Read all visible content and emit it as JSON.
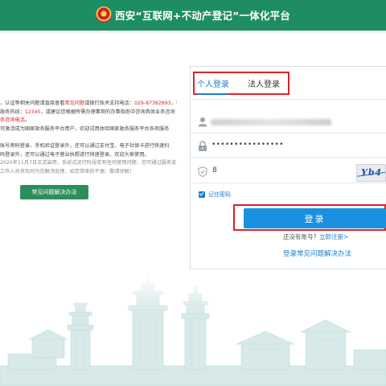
{
  "header": {
    "title": "西安“互联网+不动产登记”一体化平台",
    "bg_color": "#1f8d63"
  },
  "notice": {
    "lines": [
      {
        "parts": [
          {
            "text": "、认证等相关问题请直接查看",
            "c": ""
          },
          {
            "text": "常见问题",
            "c": "red"
          },
          {
            "text": "或拨打技术支持电话：",
            "c": ""
          },
          {
            "text": "029-87382893",
            "c": "red"
          },
          {
            "text": "，若",
            "c": ""
          }
        ]
      },
      {
        "parts": [
          {
            "text": "政务热线：",
            "c": ""
          },
          {
            "text": "12345",
            "c": "red"
          },
          {
            "text": "，或建议您根据所需办理事项的办事指南中咨询具体业务咨询",
            "c": ""
          }
        ]
      },
      {
        "parts": [
          {
            "text": "务咨询电话",
            "c": "red"
          },
          {
            "text": "。",
            "c": ""
          }
        ]
      },
      {
        "parts": [
          {
            "text": "可激活成为国家政务服务平台用户，欢迎试用体验国家政务服务平台各项服务",
            "c": ""
          }
        ]
      },
      {
        "parts": [
          {
            "text": "",
            "c": ""
          }
        ]
      },
      {
        "parts": [
          {
            "text": "账号密码登录、手机验证登录外，还可以通过支付宝、电子社保卡进行快速扫",
            "c": ""
          }
        ]
      },
      {
        "parts": [
          {
            "text": "码登录外，还可以通过电子营业执照进行快速登录。欢迎大家使用。",
            "c": ""
          }
        ]
      },
      {
        "parts": [
          {
            "text": "2020年11月7日正式启用，系统试运行阶段若有任何使用问题，您可通过服务支",
            "c": "gray"
          }
        ]
      },
      {
        "parts": [
          {
            "text": "工作人员将及时为您解决处理，给您带来的不便，敬请谅解！",
            "c": "gray"
          }
        ]
      }
    ],
    "faq_button": "常见问题解决办法"
  },
  "login": {
    "tabs": [
      {
        "label": "个人登录",
        "active": true
      },
      {
        "label": "法人登录",
        "active": false
      }
    ],
    "password_value": "••••••••••••••••",
    "captcha_value": "8",
    "captcha_image_text": "Yb4",
    "remember_label": "记住密码",
    "submit_label": "登录",
    "no_account_text": "还没有账号？",
    "register_link": "立即注册>",
    "faq_link": "登录常见问题解决办法",
    "accent_color": "#1a7fcf",
    "highlight_color": "#d9252a"
  }
}
